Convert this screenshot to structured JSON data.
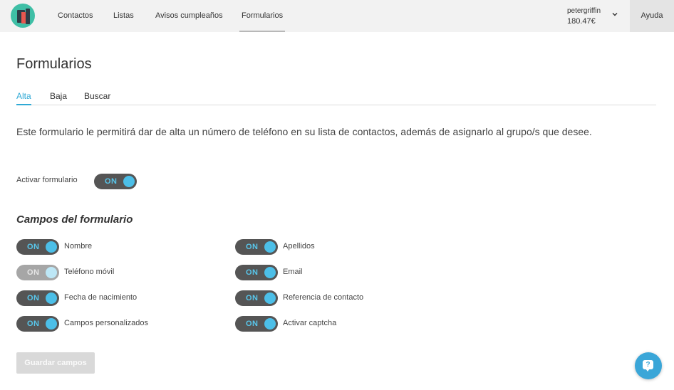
{
  "nav": {
    "items": [
      {
        "label": "Contactos"
      },
      {
        "label": "Listas"
      },
      {
        "label": "Avisos cumpleaños"
      },
      {
        "label": "Formularios",
        "active": true
      }
    ],
    "user": {
      "name": "petergriffin",
      "balance": "180.47€"
    },
    "help_label": "Ayuda"
  },
  "page": {
    "title": "Formularios",
    "tabs": [
      {
        "label": "Alta",
        "active": true
      },
      {
        "label": "Baja"
      },
      {
        "label": "Buscar"
      }
    ],
    "intro": "Este formulario le permitirá dar de alta un número de teléfono en su lista de contactos, además de asignarlo al grupo/s que desee.",
    "activar": {
      "label": "Activar formulario",
      "state": "ON"
    }
  },
  "fields_section": {
    "title": "Campos del formulario",
    "fields": [
      {
        "label": "Nombre",
        "state": "ON",
        "enabled": true
      },
      {
        "label": "Apellidos",
        "state": "ON",
        "enabled": true
      },
      {
        "label": "Teléfono móvil",
        "state": "ON",
        "enabled": false
      },
      {
        "label": "Email",
        "state": "ON",
        "enabled": true
      },
      {
        "label": "Fecha de nacimiento",
        "state": "ON",
        "enabled": true
      },
      {
        "label": "Referencia de contacto",
        "state": "ON",
        "enabled": true
      },
      {
        "label": "Campos personalizados",
        "state": "ON",
        "enabled": true
      },
      {
        "label": "Activar captcha",
        "state": "ON",
        "enabled": true
      }
    ]
  },
  "save_button": {
    "label": "Guardar campos"
  },
  "chat": {
    "icon": "chat-help-icon",
    "glyph": "?"
  },
  "colors": {
    "accent": "#2fa9d5",
    "toggle_on_bg": "#555555",
    "toggle_knob": "#4cbfe8",
    "logo": "#3fbfa6"
  }
}
